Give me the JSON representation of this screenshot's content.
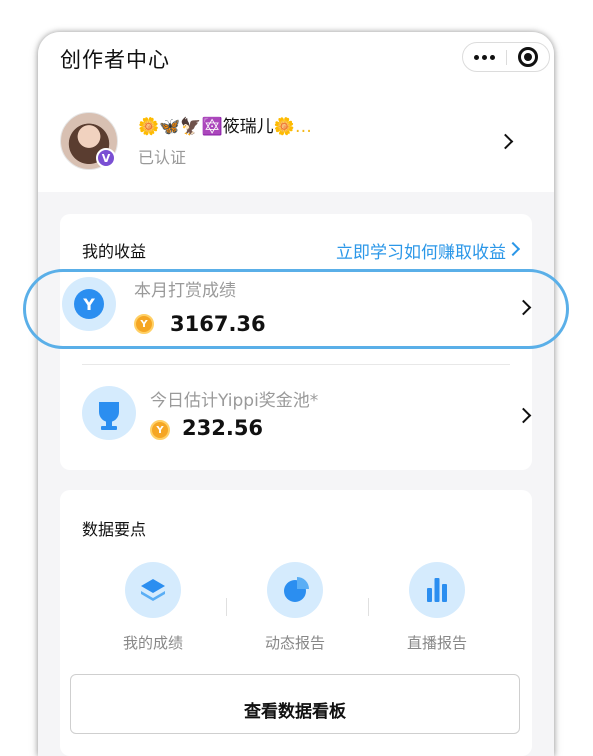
{
  "app": {
    "title": "创作者中心"
  },
  "profile": {
    "nickname_prefix": "🌼",
    "nickname_mid": "🦋🦅",
    "nickname_star": "🔯",
    "nickname_text": "筱瑞儿",
    "nickname_suffix": "🌼…",
    "badge": "V",
    "status": "已认证"
  },
  "earnings": {
    "title": "我的收益",
    "learn_link": "立即学习如何赚取收益",
    "monthly": {
      "label": "本月打赏成绩",
      "value": "3167.36",
      "icon_letter": "Y"
    },
    "daily": {
      "label": "今日估计Yippi奖金池*",
      "value": "232.56"
    }
  },
  "data_points": {
    "title": "数据要点",
    "items": [
      {
        "label": "我的成绩",
        "icon": "layers-icon"
      },
      {
        "label": "动态报告",
        "icon": "pie-chart-icon"
      },
      {
        "label": "直播报告",
        "icon": "bar-chart-icon"
      }
    ],
    "dashboard_button": "查看数据看板"
  },
  "colors": {
    "accent": "#2b97e8",
    "highlight": "#5aafe8",
    "coin": "#f5a623",
    "badge": "#7a4fd3"
  }
}
